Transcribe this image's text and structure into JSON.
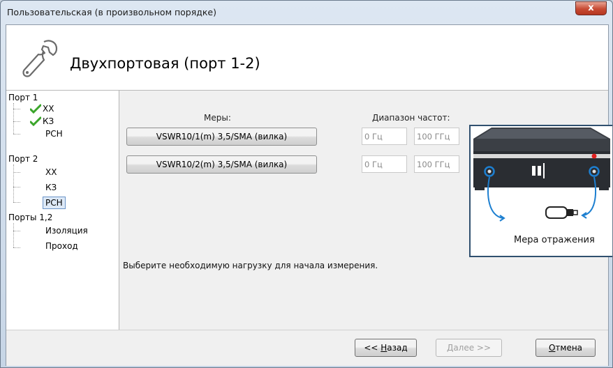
{
  "window": {
    "title": "Пользовательская (в произвольном порядке)",
    "close_glyph": "x"
  },
  "header": {
    "title": "Двухпортовая (порт 1-2)",
    "icon": "wrench-icon"
  },
  "tree": {
    "port1": {
      "label": "Порт 1",
      "items": [
        {
          "label": "ХХ",
          "done": true
        },
        {
          "label": "КЗ",
          "done": true
        },
        {
          "label": "РСН",
          "done": false
        }
      ]
    },
    "port2": {
      "label": "Порт 2",
      "items": [
        {
          "label": "ХХ",
          "done": false
        },
        {
          "label": "КЗ",
          "done": false
        },
        {
          "label": "РСН",
          "done": false,
          "selected": true
        }
      ]
    },
    "ports12": {
      "label": "Порты 1,2",
      "items": [
        {
          "label": "Изоляция"
        },
        {
          "label": "Проход"
        }
      ]
    }
  },
  "content": {
    "measures_label": "Меры:",
    "freq_label": "Диапазон частот:",
    "rows": [
      {
        "measure": "VSWR10/1(m) 3,5/SMA (вилка)",
        "freq_from": "0 Гц",
        "freq_to": "100 ГГц"
      },
      {
        "measure": "VSWR10/2(m) 3,5/SMA (вилка)",
        "freq_from": "0 Гц",
        "freq_to": "100 ГГц"
      }
    ],
    "instruction": "Выберите необходимую нагрузку для начала измерения.",
    "illustration_caption": "Мера отражения"
  },
  "footer": {
    "back": {
      "prefix": "<< ",
      "mnemonic": "Н",
      "rest": "азад"
    },
    "next": {
      "prefix": "",
      "mnemonic": "Д",
      "rest": "алее >>"
    },
    "cancel": {
      "prefix": "",
      "mnemonic": "О",
      "rest": "тмена"
    }
  },
  "colors": {
    "check_green": "#3aa52a",
    "port_ring": "#1d7fd0",
    "led_red": "#e02020",
    "panel_border": "#30506f"
  }
}
